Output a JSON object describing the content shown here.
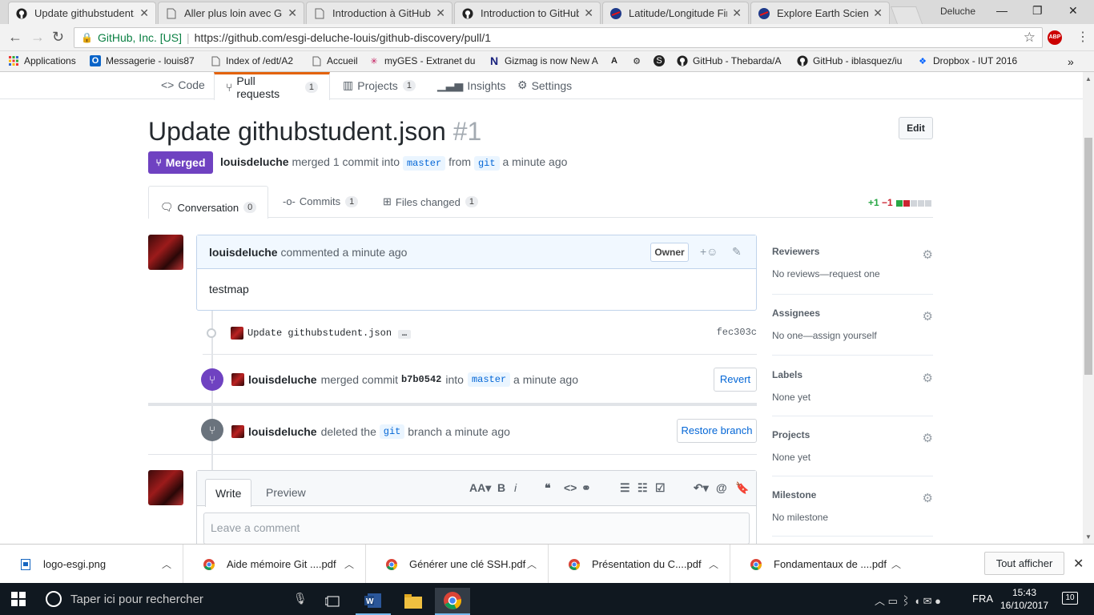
{
  "browser": {
    "tabs": [
      {
        "title": "Update githubstudent.j",
        "icon": "github-icon"
      },
      {
        "title": "Aller plus loin avec Git",
        "icon": "document-icon"
      },
      {
        "title": "Introduction à GitHub",
        "icon": "document-icon"
      },
      {
        "title": "Introduction to GitHub",
        "icon": "github-icon"
      },
      {
        "title": "Latitude/Longitude Fin",
        "icon": "nasa-icon"
      },
      {
        "title": "Explore Earth Science D",
        "icon": "nasa-icon"
      }
    ],
    "profile": "Deluche",
    "address": {
      "secure_label": "GitHub, Inc. [US]",
      "url": "https://github.com/esgi-deluche-louis/github-discovery/pull/1"
    },
    "abp_badge": "ABP",
    "bookmarks": [
      "Applications",
      "Messagerie - louis87",
      "Index of /edt/A2",
      "Accueil",
      "myGES - Extranet du",
      "Gizmag is now New A",
      "",
      "",
      "",
      "GitHub - Thebarda/A",
      "GitHub - iblasquez/iu",
      "Dropbox - IUT 2016"
    ]
  },
  "repo_nav": {
    "code": "Code",
    "pull_requests": "Pull requests",
    "pull_requests_count": "1",
    "projects": "Projects",
    "projects_count": "1",
    "insights": "Insights",
    "settings": "Settings"
  },
  "pr": {
    "title": "Update githubstudent.json",
    "number": "#1",
    "edit_label": "Edit",
    "state": "Merged",
    "author": "louisdeluche",
    "merge_text": "merged 1 commit into",
    "base_branch": "master",
    "from_text": "from",
    "head_branch": "git",
    "time": "a minute ago"
  },
  "pr_tabs": {
    "conversation": "Conversation",
    "conversation_count": "0",
    "commits": "Commits",
    "commits_count": "1",
    "files": "Files changed",
    "files_count": "1",
    "additions": "+1",
    "deletions": "−1"
  },
  "comment": {
    "author": "louisdeluche",
    "action": "commented",
    "time": "a minute ago",
    "badge": "Owner",
    "body": "testmap"
  },
  "commit": {
    "message": "Update githubstudent.json",
    "more": "…",
    "sha": "fec303c"
  },
  "merge_event": {
    "author": "louisdeluche",
    "text": "merged commit",
    "sha": "b7b0542",
    "into": "into",
    "branch": "master",
    "time": "a minute ago",
    "button": "Revert"
  },
  "delete_event": {
    "author": "louisdeluche",
    "text": "deleted the",
    "branch": "git",
    "suffix": "branch a minute ago",
    "button": "Restore branch"
  },
  "composer": {
    "write_tab": "Write",
    "preview_tab": "Preview",
    "placeholder": "Leave a comment",
    "toolbar": {
      "header": "AA",
      "bold": "B",
      "italic": "i"
    }
  },
  "sidebar": [
    {
      "title": "Reviewers",
      "value": "No reviews—request one"
    },
    {
      "title": "Assignees",
      "value": "No one—assign yourself"
    },
    {
      "title": "Labels",
      "value": "None yet"
    },
    {
      "title": "Projects",
      "value": "None yet"
    },
    {
      "title": "Milestone",
      "value": "No milestone"
    }
  ],
  "downloads": {
    "items": [
      "logo-esgi.png",
      "Aide mémoire Git ....pdf",
      "Générer une clé SSH.pdf",
      "Présentation du C....pdf",
      "Fondamentaux de ....pdf"
    ],
    "show_all": "Tout afficher"
  },
  "taskbar": {
    "search_placeholder": "Taper ici pour rechercher",
    "language": "FRA",
    "time": "15:43",
    "date": "16/10/2017",
    "notifications": "10"
  },
  "colors": {
    "merged": "#6f42c1",
    "link": "#0366d6",
    "addition": "#28a745",
    "deletion": "#cb2431",
    "tab_accent": "#e36209"
  }
}
